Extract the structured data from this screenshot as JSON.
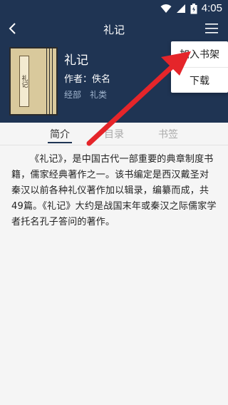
{
  "status": {
    "time": "4:05"
  },
  "nav": {
    "title": "礼记"
  },
  "book": {
    "title": "礼记",
    "cover_title": "礼记",
    "author": "作者：佚名",
    "category": "经部",
    "subcategory": "礼类"
  },
  "menu": {
    "items": [
      "加入书架",
      "下载"
    ]
  },
  "tabs": {
    "items": [
      "简介",
      "目录",
      "书签"
    ]
  },
  "intro": {
    "text": "《礼记》，是中国古代一部重要的典章制度书籍，儒家经典著作之一。该书编定是西汉戴圣对秦汉以前各种礼仪著作加以辑录，编纂而成，共49篇。《礼记》大约是战国末年或秦汉之际儒家学者托名孔子答问的著作。"
  },
  "colors": {
    "header": "#1f3453",
    "arrow": "#e5252a"
  }
}
